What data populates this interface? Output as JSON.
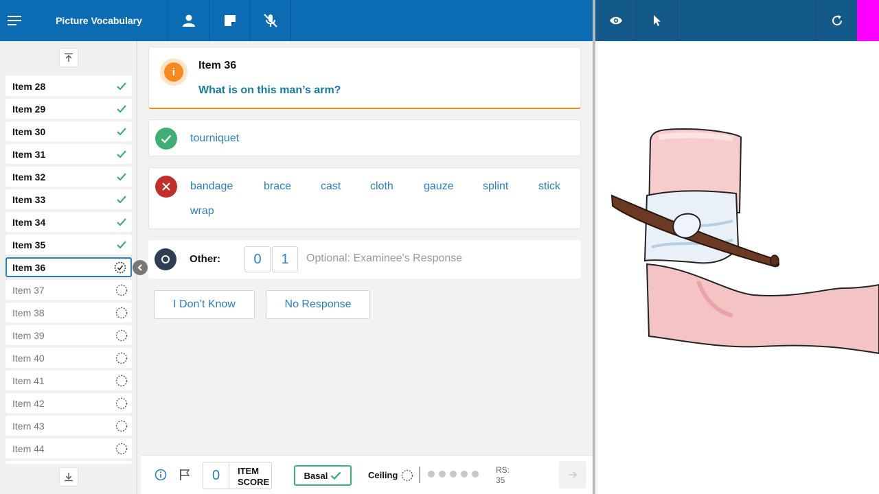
{
  "app": {
    "title": "Picture Vocabulary"
  },
  "sidebar": {
    "items": [
      {
        "label": "Item 28",
        "status": "done"
      },
      {
        "label": "Item 29",
        "status": "done"
      },
      {
        "label": "Item 30",
        "status": "done"
      },
      {
        "label": "Item 31",
        "status": "done"
      },
      {
        "label": "Item 32",
        "status": "done"
      },
      {
        "label": "Item 33",
        "status": "done"
      },
      {
        "label": "Item 34",
        "status": "done"
      },
      {
        "label": "Item 35",
        "status": "done"
      },
      {
        "label": "Item 36",
        "status": "current"
      },
      {
        "label": "Item 37",
        "status": "pending"
      },
      {
        "label": "Item 38",
        "status": "pending"
      },
      {
        "label": "Item 39",
        "status": "pending"
      },
      {
        "label": "Item 40",
        "status": "pending"
      },
      {
        "label": "Item 41",
        "status": "pending"
      },
      {
        "label": "Item 42",
        "status": "pending"
      },
      {
        "label": "Item 43",
        "status": "pending"
      },
      {
        "label": "Item 44",
        "status": "pending"
      }
    ]
  },
  "question": {
    "item_label": "Item 36",
    "text": "What is on this man’s arm?"
  },
  "correct": {
    "answers": [
      "tourniquet"
    ]
  },
  "incorrect": {
    "answers": [
      "bandage",
      "brace",
      "cast",
      "cloth",
      "gauze",
      "splint",
      "stick",
      "wrap"
    ]
  },
  "other": {
    "label": "Other:",
    "score_0": "0",
    "score_1": "1",
    "placeholder": "Optional: Examinee's Response"
  },
  "buttons": {
    "dont_know": "I Don’t Know",
    "no_response": "No Response"
  },
  "footer": {
    "item_score_value": "0",
    "item_score_line1": "ITEM",
    "item_score_line2": "SCORE",
    "basal_label": "Basal",
    "ceiling_label": "Ceiling",
    "rs_label": "RS:",
    "rs_value": "35"
  },
  "colors": {
    "primary": "#0b6cb3",
    "accent_orange": "#f58a1f",
    "correct_green": "#3fae74",
    "incorrect_red": "#c2302e",
    "link_blue": "#2a7fc1"
  }
}
